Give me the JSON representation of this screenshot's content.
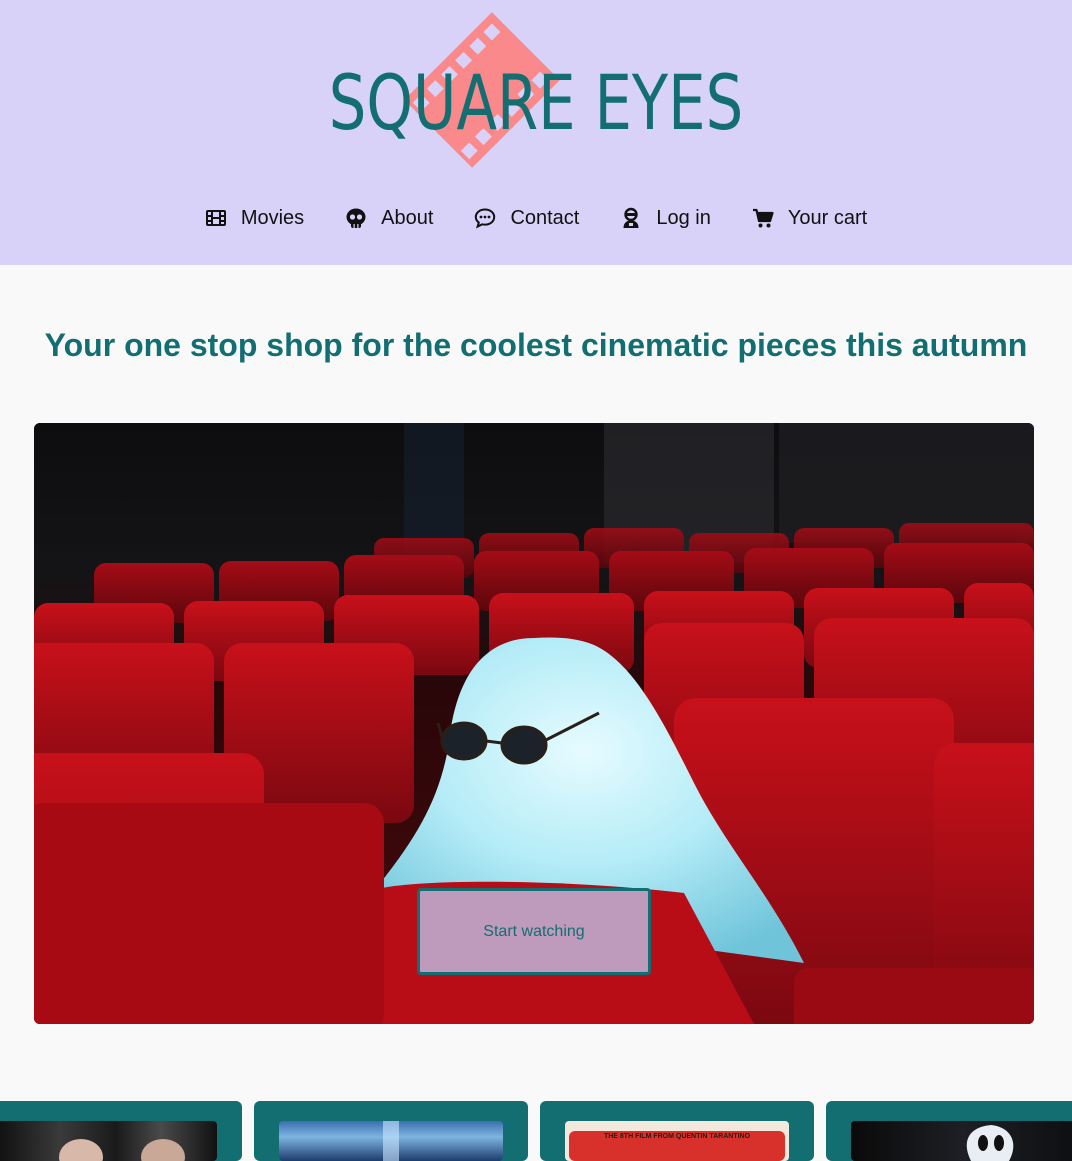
{
  "header": {
    "logo_text": "SQUARE EYES",
    "nav": [
      {
        "label": "Movies",
        "icon": "film-icon"
      },
      {
        "label": "About",
        "icon": "skull-icon"
      },
      {
        "label": "Contact",
        "icon": "chat-icon"
      },
      {
        "label": "Log in",
        "icon": "user-icon"
      },
      {
        "label": "Your cart",
        "icon": "cart-icon"
      }
    ]
  },
  "main": {
    "tagline": "Your one stop shop for the coolest cinematic pieces this autumn",
    "hero": {
      "image": "ghost-in-cinema-image",
      "button_label": "Start watching"
    },
    "movies": [
      {
        "poster": "movie-poster-1"
      },
      {
        "poster": "movie-poster-2"
      },
      {
        "poster": "movie-poster-3",
        "poster_text": "THE 8TH FILM FROM QUENTIN TARANTINO"
      },
      {
        "poster": "movie-poster-4"
      }
    ]
  },
  "colors": {
    "header_bg": "#d8d2f8",
    "brand_teal": "#136e72",
    "logo_accent": "#f9898b",
    "page_bg": "#f9f9f9"
  }
}
